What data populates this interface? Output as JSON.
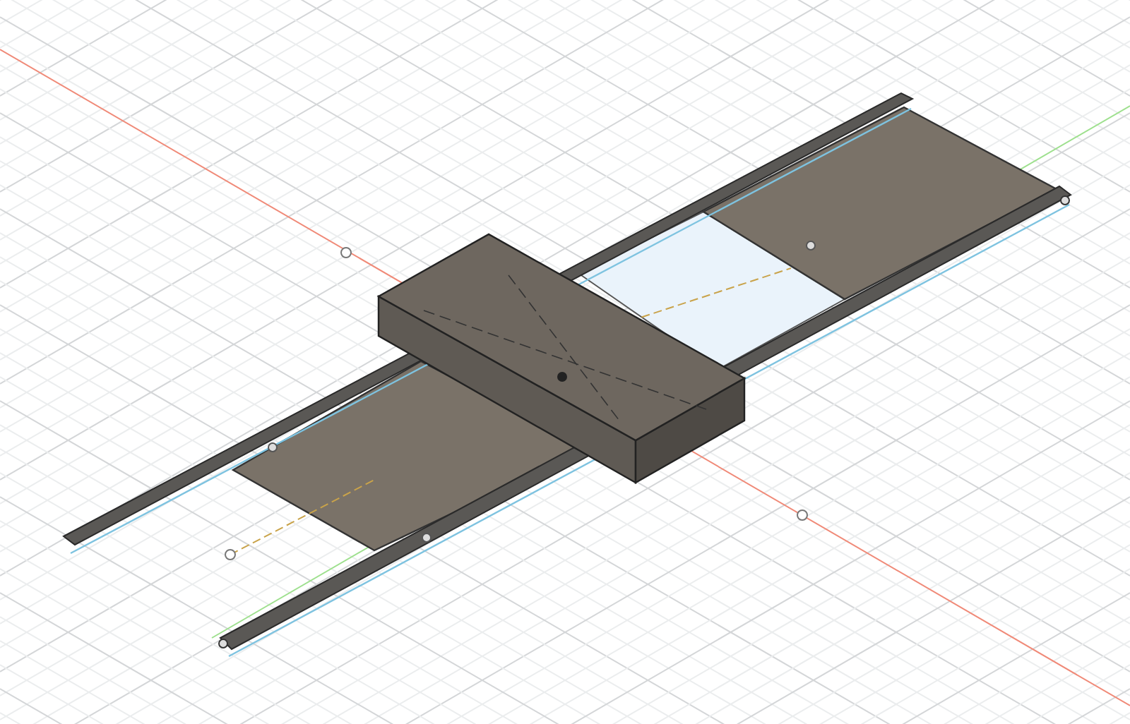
{
  "viewport": {
    "kind": "model-view",
    "show_grid": true,
    "show_axes": true
  }
}
